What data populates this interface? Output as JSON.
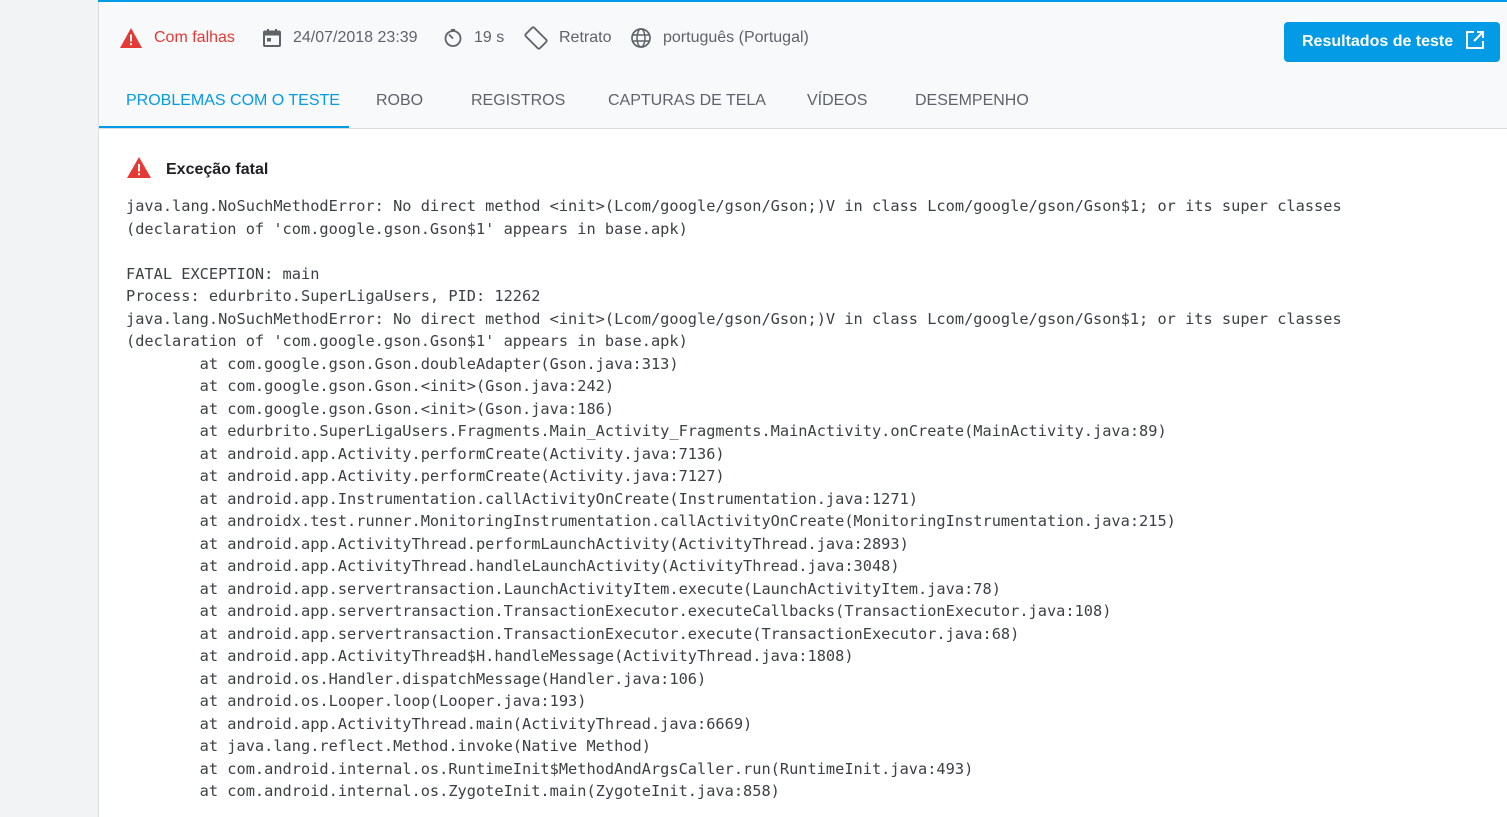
{
  "header": {
    "status": "Com falhas",
    "date": "24/07/2018 23:39",
    "duration": "19 s",
    "orientation": "Retrato",
    "locale": "português (Portugal)",
    "results_button": "Resultados de teste",
    "status_color": "#e53935",
    "accent_color": "#039be5"
  },
  "tabs": [
    {
      "label": "PROBLEMAS COM O TESTE",
      "active": true
    },
    {
      "label": "ROBO"
    },
    {
      "label": "REGISTROS"
    },
    {
      "label": "CAPTURAS DE TELA"
    },
    {
      "label": "VÍDEOS"
    },
    {
      "label": "DESEMPENHO"
    }
  ],
  "issue": {
    "title": "Exceção fatal",
    "icon": "warning-icon",
    "trace_lines": [
      "java.lang.NoSuchMethodError: No direct method <init>(Lcom/google/gson/Gson;)V in class Lcom/google/gson/Gson$1; or its super classes",
      "(declaration of 'com.google.gson.Gson$1' appears in base.apk)",
      "",
      "FATAL EXCEPTION: main",
      "Process: edurbrito.SuperLigaUsers, PID: 12262",
      "java.lang.NoSuchMethodError: No direct method <init>(Lcom/google/gson/Gson;)V in class Lcom/google/gson/Gson$1; or its super classes",
      "(declaration of 'com.google.gson.Gson$1' appears in base.apk)",
      "        at com.google.gson.Gson.doubleAdapter(Gson.java:313)",
      "        at com.google.gson.Gson.<init>(Gson.java:242)",
      "        at com.google.gson.Gson.<init>(Gson.java:186)",
      "        at edurbrito.SuperLigaUsers.Fragments.Main_Activity_Fragments.MainActivity.onCreate(MainActivity.java:89)",
      "        at android.app.Activity.performCreate(Activity.java:7136)",
      "        at android.app.Activity.performCreate(Activity.java:7127)",
      "        at android.app.Instrumentation.callActivityOnCreate(Instrumentation.java:1271)",
      "        at androidx.test.runner.MonitoringInstrumentation.callActivityOnCreate(MonitoringInstrumentation.java:215)",
      "        at android.app.ActivityThread.performLaunchActivity(ActivityThread.java:2893)",
      "        at android.app.ActivityThread.handleLaunchActivity(ActivityThread.java:3048)",
      "        at android.app.servertransaction.LaunchActivityItem.execute(LaunchActivityItem.java:78)",
      "        at android.app.servertransaction.TransactionExecutor.executeCallbacks(TransactionExecutor.java:108)",
      "        at android.app.servertransaction.TransactionExecutor.execute(TransactionExecutor.java:68)",
      "        at android.app.ActivityThread$H.handleMessage(ActivityThread.java:1808)",
      "        at android.os.Handler.dispatchMessage(Handler.java:106)",
      "        at android.os.Looper.loop(Looper.java:193)",
      "        at android.app.ActivityThread.main(ActivityThread.java:6669)",
      "        at java.lang.reflect.Method.invoke(Native Method)",
      "        at com.android.internal.os.RuntimeInit$MethodAndArgsCaller.run(RuntimeInit.java:493)",
      "        at com.android.internal.os.ZygoteInit.main(ZygoteInit.java:858)"
    ]
  }
}
